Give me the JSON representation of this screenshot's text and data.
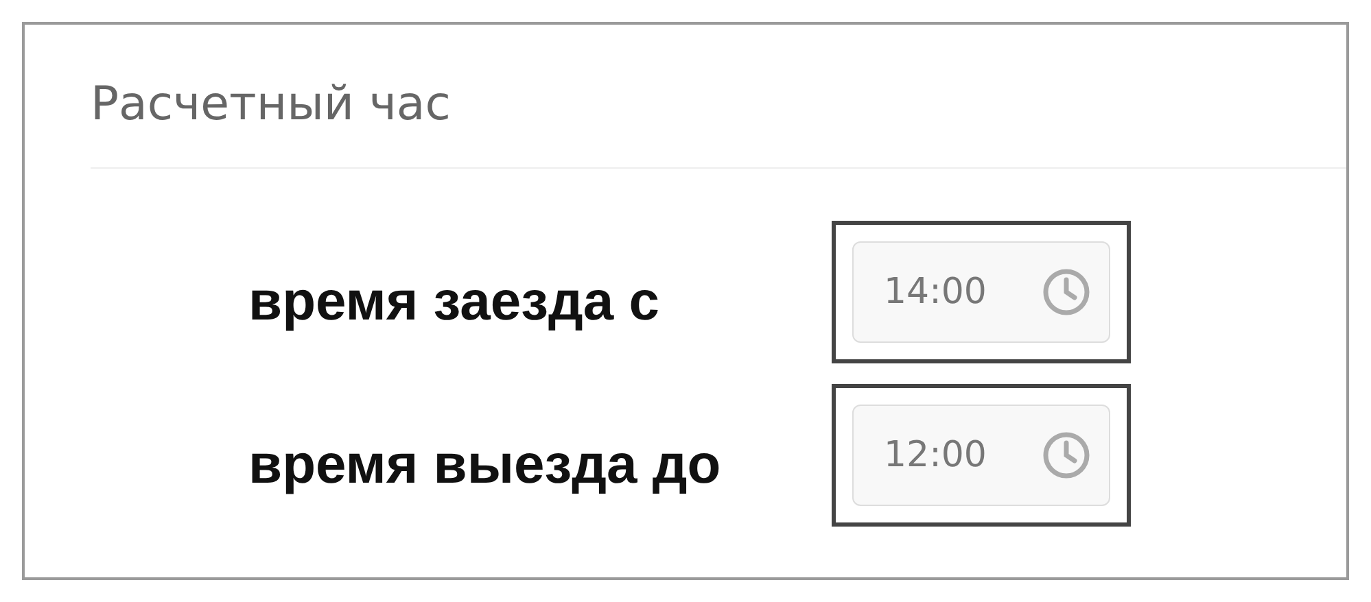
{
  "panel": {
    "title": "Расчетный час"
  },
  "rows": [
    {
      "label": "время заезда с",
      "value": "14:00"
    },
    {
      "label": "время выезда до",
      "value": "12:00"
    }
  ]
}
